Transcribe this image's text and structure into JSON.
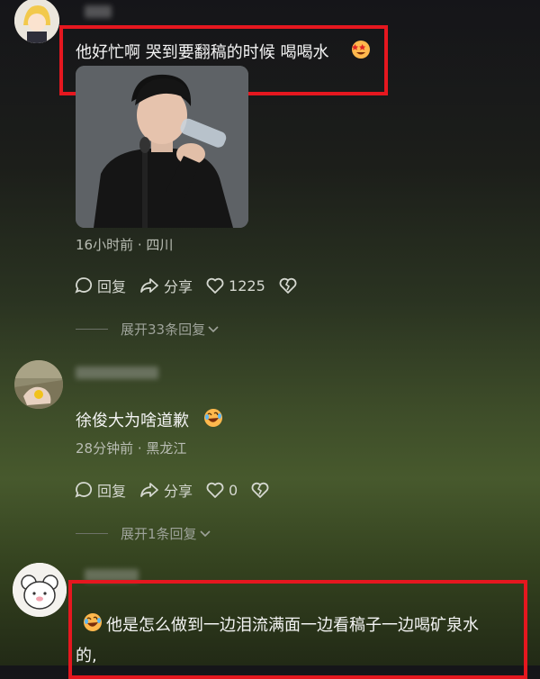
{
  "comments": [
    {
      "text": "他好忙啊 哭到要翻稿的时候 喝喝水",
      "meta": "16小时前 · 四川",
      "reply_label": "回复",
      "share_label": "分享",
      "likes": "1225",
      "expand_label": "展开33条回复"
    },
    {
      "text": "徐俊大为啥道歉",
      "meta": "28分钟前 · 黑龙江",
      "reply_label": "回复",
      "share_label": "分享",
      "likes": "0",
      "expand_label": "展开1条回复"
    },
    {
      "text_line1": "他是怎么做到一边泪流满面一边看稿子一边喝矿泉水",
      "text_line2": "的,"
    }
  ],
  "colors": {
    "highlight": "#e5171f",
    "background_top": "#151519",
    "background_mid": "#47592d"
  },
  "icons": [
    "reply-bubble-icon",
    "share-arrow-icon",
    "heart-icon",
    "broken-heart-icon",
    "chevron-down-icon",
    "starstruck-emoji",
    "laughing-emoji"
  ]
}
